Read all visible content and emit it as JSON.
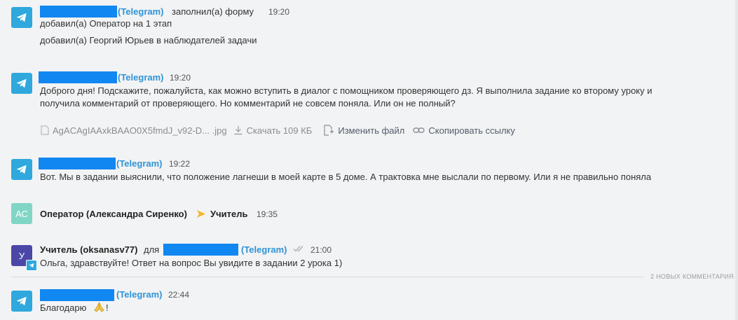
{
  "comments": {
    "c1": {
      "source": "(Telegram)",
      "action": "заполнил(а) форму",
      "time": "19:20",
      "line1": "добавил(а) Оператор на 1 этап",
      "line2": "добавил(а) Георгий Юрьев в наблюдателей задачи"
    },
    "c2": {
      "source": "(Telegram)",
      "time": "19:20",
      "text1": "Доброго дня! Подскажите, пожалуйста, как можно вступить в диалог с помощником проверяющего дз. Я выполнила задание ко второму уроку и",
      "text2": "получила комментарий от проверяющего. Но комментарий не совсем поняла. Или он не полный?",
      "file_name": "AgACAgIAAxkBAAO0X5fmdJ_v92-D... .jpg",
      "download": "Скачать 109 КБ",
      "edit_file": "Изменить файл",
      "copy_link": "Скопировать ссылку"
    },
    "c3": {
      "source": "(Telegram)",
      "time": "19:22",
      "text": "Вот. Мы в задании выяснили, что положение лагнеши в моей карте в 5 доме. А трактовка мне выслали по первому. Или я не правильно поняла"
    },
    "c4": {
      "avatar": "АС",
      "from": "Оператор (Александра Сиренко)",
      "to": "Учитель",
      "time": "19:35"
    },
    "c5": {
      "avatar": "У",
      "from": "Учитель (oksanasv77)",
      "for_word": "для",
      "source": "(Telegram)",
      "time": "21:00",
      "text": "Ольга, здравствуйте! Ответ на вопрос Вы увидите в задании 2 урока 1)"
    },
    "divider": "2 НОВЫХ КОММЕНТАРИЯ",
    "c6": {
      "source": "(Telegram)",
      "time": "22:44",
      "text": "Благодарю",
      "after_emoji": "!"
    }
  },
  "colors": {
    "telegram": "#2fa8dd",
    "redaction": "#1187f1",
    "link": "#2f94d6",
    "arrow": "#f3b42d"
  },
  "icons": [
    "telegram-icon",
    "file-icon",
    "download-icon",
    "edit-file-icon",
    "link-icon",
    "arrow-right-icon",
    "double-check-icon",
    "pray-emoji-icon"
  ]
}
